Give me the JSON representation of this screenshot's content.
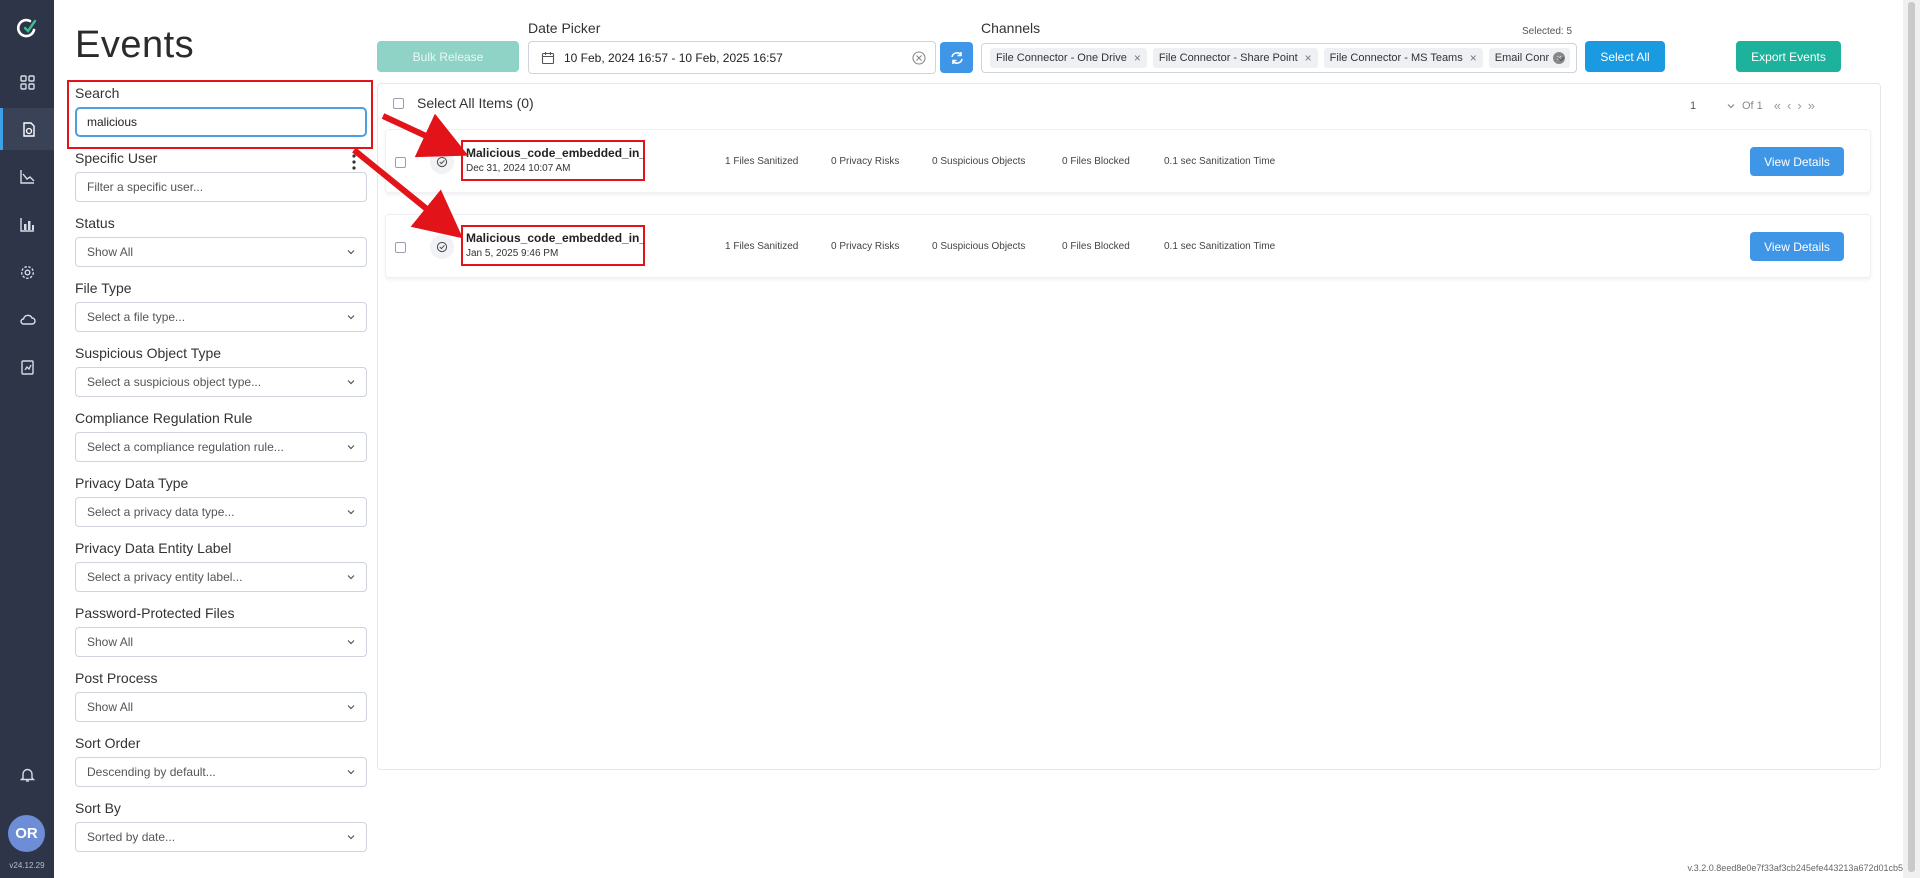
{
  "app": {
    "title": "Events",
    "version": "v24.12.29",
    "build": "v.3.2.0.8eed8e0e7f33af3cb245efe443213a672d01cb57"
  },
  "user": {
    "initials": "OR"
  },
  "sidebar": {
    "items": [
      {
        "name": "dashboard",
        "icon": "grid-icon"
      },
      {
        "name": "events",
        "icon": "file-shield-icon",
        "active": true
      },
      {
        "name": "analytics",
        "icon": "line-chart-icon"
      },
      {
        "name": "reports",
        "icon": "bar-chart-icon"
      },
      {
        "name": "settings",
        "icon": "gear-icon"
      },
      {
        "name": "cloud",
        "icon": "cloud-icon"
      },
      {
        "name": "audit",
        "icon": "document-chart-icon"
      }
    ]
  },
  "filters": {
    "search": {
      "label": "Search",
      "value": "malicious"
    },
    "specific_user": {
      "label": "Specific User",
      "placeholder": "Filter a specific user..."
    },
    "status": {
      "label": "Status",
      "value": "Show All"
    },
    "file_type": {
      "label": "File Type",
      "value": "Select a file type..."
    },
    "suspicious_object_type": {
      "label": "Suspicious Object Type",
      "value": "Select a suspicious object type..."
    },
    "compliance_rule": {
      "label": "Compliance Regulation Rule",
      "value": "Select a compliance regulation rule..."
    },
    "privacy_data_type": {
      "label": "Privacy Data Type",
      "value": "Select a privacy data type..."
    },
    "privacy_entity_label": {
      "label": "Privacy Data Entity Label",
      "value": "Select a privacy entity label..."
    },
    "password_protected": {
      "label": "Password-Protected Files",
      "value": "Show All"
    },
    "post_process": {
      "label": "Post Process",
      "value": "Show All"
    },
    "sort_order": {
      "label": "Sort Order",
      "value": "Descending by default..."
    },
    "sort_by": {
      "label": "Sort By",
      "value": "Sorted by date..."
    }
  },
  "toolbar": {
    "bulk_release": "Bulk Release",
    "date_picker_label": "Date Picker",
    "date_range": "10 Feb, 2024 16:57 - 10 Feb, 2025 16:57",
    "channels_label": "Channels",
    "selected_count": "Selected: 5",
    "channels": [
      "File Connector - One Drive",
      "File Connector - Share Point",
      "File Connector - MS Teams",
      "Email Conr"
    ],
    "select_all": "Select All",
    "export_events": "Export Events"
  },
  "list": {
    "select_all_label": "Select All Items (0)",
    "pagination": {
      "page": "1",
      "of": "Of 1"
    },
    "events": [
      {
        "name": "Malicious_code_embedded_in_image",
        "date": "Dec 31, 2024 10:07 AM",
        "files_sanitized": "1 Files Sanitized",
        "privacy_risks": "0 Privacy Risks",
        "suspicious_objects": "0 Suspicious Objects",
        "files_blocked": "0 Files Blocked",
        "sanitization_time": "0.1 sec Sanitization Time",
        "action": "View Details"
      },
      {
        "name": "Malicious_code_embedded_in_image",
        "date": "Jan 5, 2025 9:46 PM",
        "files_sanitized": "1 Files Sanitized",
        "privacy_risks": "0 Privacy Risks",
        "suspicious_objects": "0 Suspicious Objects",
        "files_blocked": "0 Files Blocked",
        "sanitization_time": "0.1 sec Sanitization Time",
        "action": "View Details"
      }
    ]
  },
  "colors": {
    "rail": "#2e3548",
    "primary": "#3f96e6",
    "teal": "#1db29b",
    "annotation": "#e2141a"
  }
}
